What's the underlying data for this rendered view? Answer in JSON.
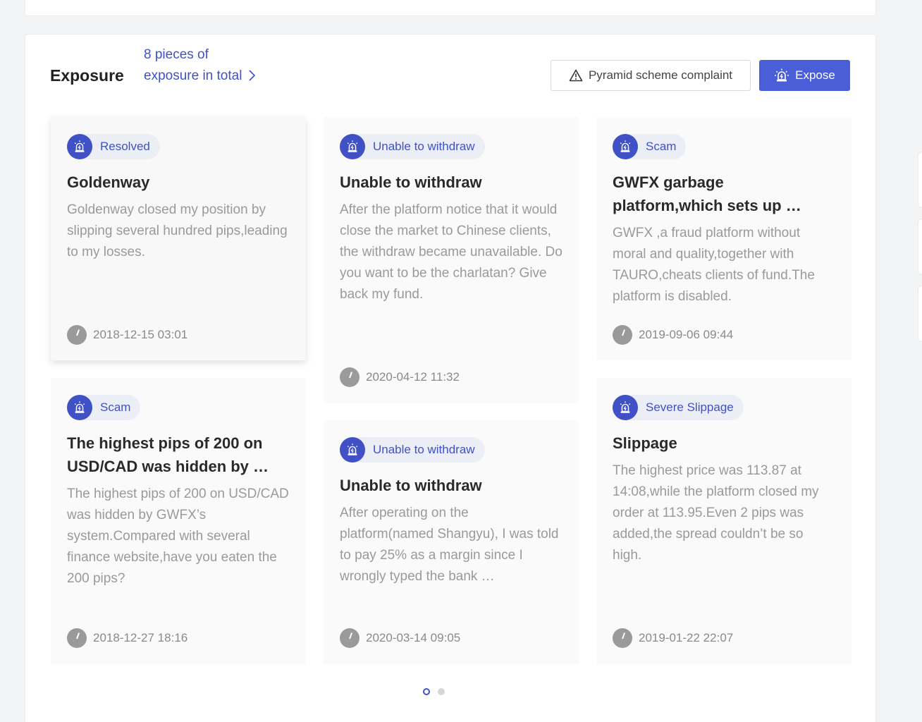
{
  "section": {
    "title": "Exposure",
    "count_text": "8 pieces of exposure in total",
    "complaint_button": "Pyramid scheme complaint",
    "expose_button": "Expose"
  },
  "cards": [
    {
      "tag": "Resolved",
      "title": "Goldenway",
      "body": "Goldenway closed my position by slipping several hundred pips,leading to my losses.",
      "time": "2018-12-15 03:01"
    },
    {
      "tag": "Unable to withdraw",
      "title": "Unable to withdraw",
      "body": "After the platform notice that it would close the market to Chinese clients, the withdraw became unavailable. Do you want to be the charlatan? Give back my fund.",
      "time": "2020-04-12 11:32"
    },
    {
      "tag": "Scam",
      "title": "GWFX garbage platform,which sets up …",
      "body": "GWFX ,a fraud platform without moral and quality,together with TAURO,cheats clients of fund.The platform is disabled.",
      "time": "2019-09-06 09:44"
    },
    {
      "tag": "Scam",
      "title": "The highest pips of 200 on USD/CAD was hidden by …",
      "body": "The highest pips of 200 on USD/CAD was hidden by GWFX’s system.Compared with several finance website,have you eaten the 200 pips?",
      "time": "2018-12-27 18:16"
    },
    {
      "tag": "Unable to withdraw",
      "title": "Unable to withdraw",
      "body": "After operating on the platform(named Shangyu), I was told to pay 25% as a margin since I wrongly typed the bank …",
      "time": "2020-03-14 09:05"
    },
    {
      "tag": "Severe Slippage",
      "title": "Slippage",
      "body": "The highest price was 113.87 at 14:08,while the platform closed my order at 113.95.Even 2 pips was added,the spread couldn’t be so high.",
      "time": "2019-01-22 22:07"
    }
  ],
  "icons": {
    "alert_badge": "alarm-light-icon",
    "warning": "warning-triangle-icon",
    "clock": "clock-icon",
    "chevron": "chevron-right-icon"
  },
  "pagination": {
    "pages": 2,
    "current": 1
  },
  "colors": {
    "accent": "#4a5ed8",
    "tag_text": "#3f51c5"
  }
}
